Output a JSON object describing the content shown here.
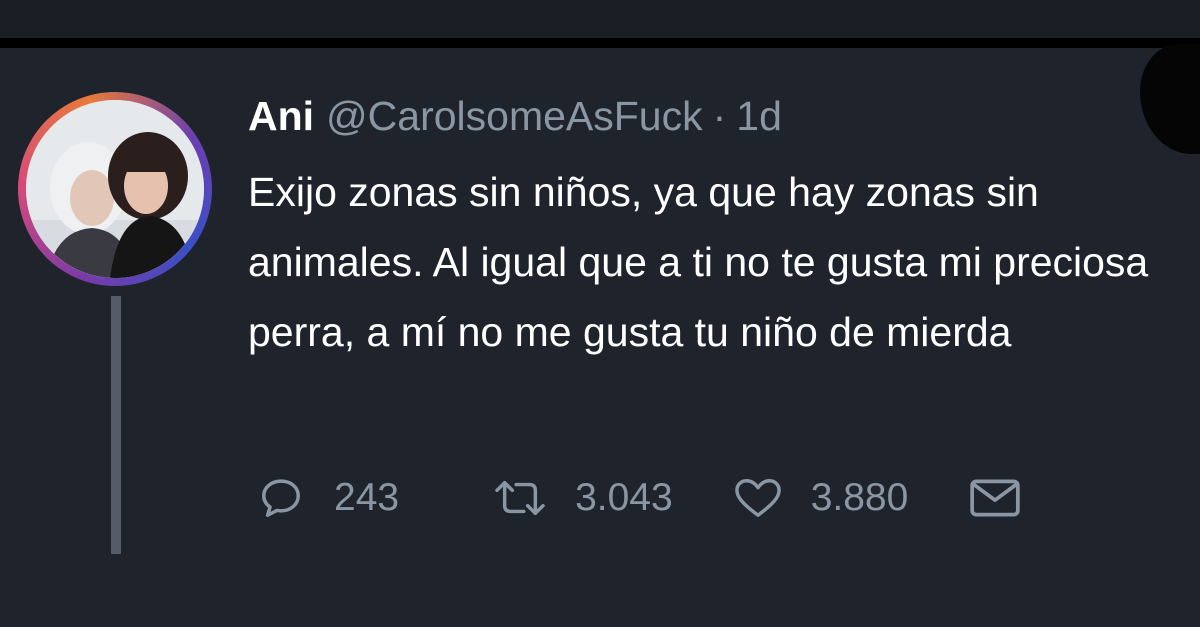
{
  "tweet": {
    "author_name": "Ani",
    "handle": "@CarolsomeAsFuck",
    "separator": "·",
    "time": "1d",
    "text": "Exijo zonas sin niños, ya que hay zonas sin animales. Al igual que a ti no te gusta mi preciosa perra, a mí no me gusta tu niño de mierda",
    "avatar_icon": "profile-photo",
    "ring_colors": [
      "#7a3aa8",
      "#d64a7a",
      "#3a4fc8"
    ]
  },
  "actions": {
    "reply_count": "243",
    "retweet_count": "3.043",
    "like_count": "3.880",
    "reply_icon": "speech-bubble",
    "retweet_icon": "retweet-arrows",
    "like_icon": "heart",
    "dm_icon": "envelope"
  },
  "colors": {
    "background": "#1f242c",
    "text": "#ffffff",
    "muted": "#8a96a3",
    "thread_line": "#535c67"
  }
}
